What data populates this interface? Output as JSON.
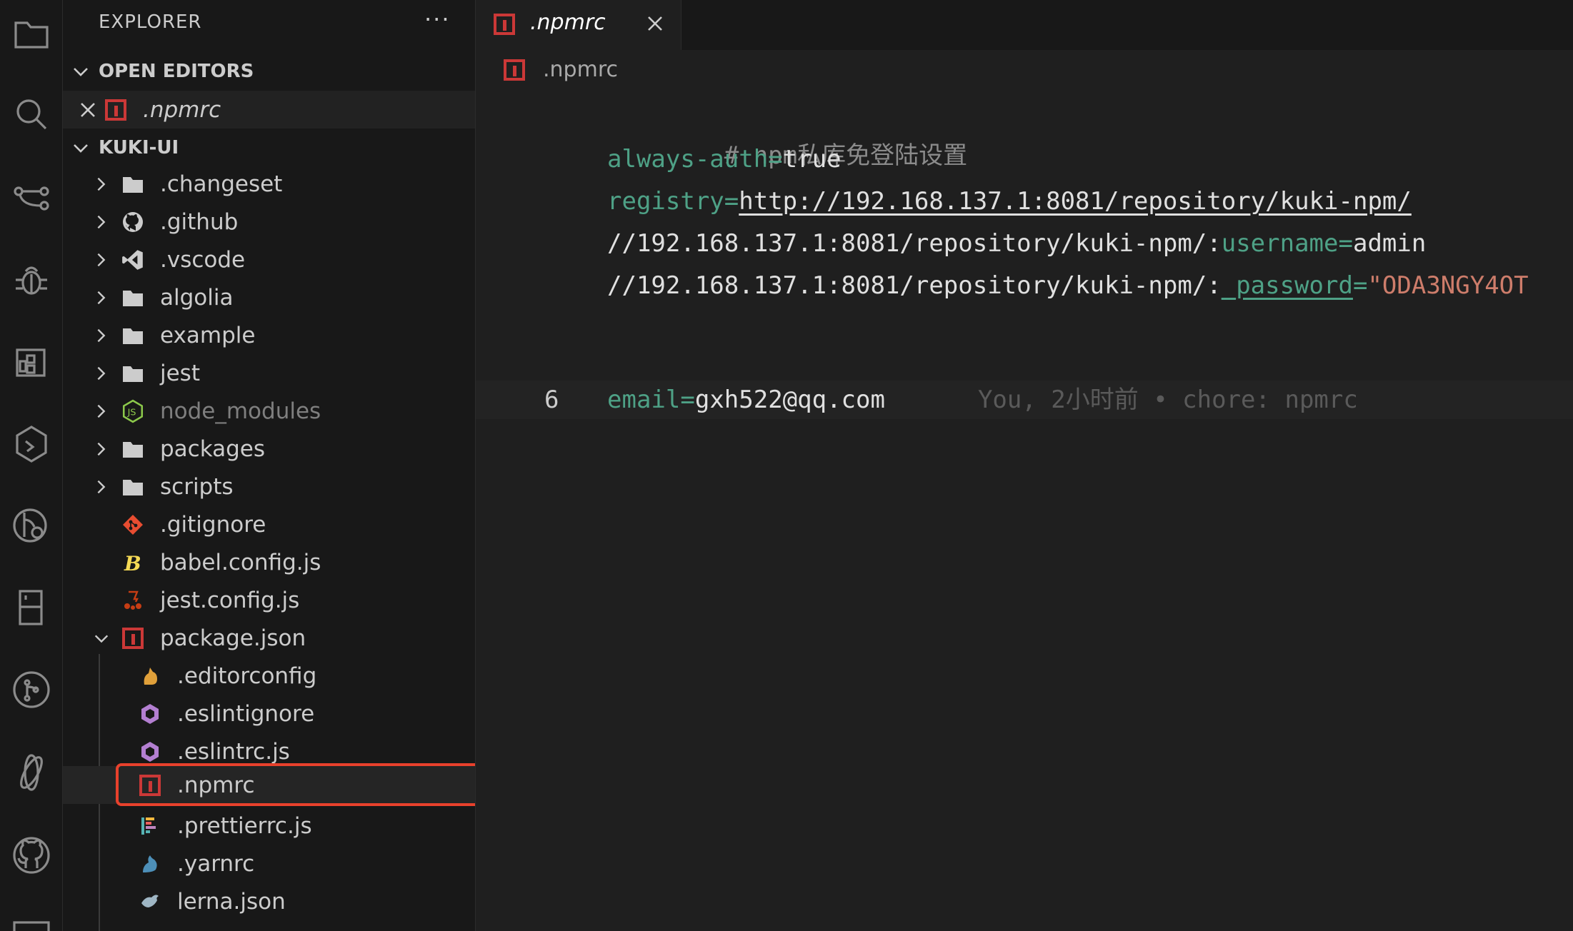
{
  "explorer": {
    "title": "EXPLORER",
    "more": "···",
    "open_editors": {
      "label": "OPEN EDITORS",
      "items": [
        ".npmrc"
      ]
    },
    "project": {
      "label": "KUKI-UI",
      "items": [
        {
          "label": ".changeset",
          "icon": "folder-icon"
        },
        {
          "label": ".github",
          "icon": "github-folder-icon"
        },
        {
          "label": ".vscode",
          "icon": "vscode-folder-icon"
        },
        {
          "label": "algolia",
          "icon": "folder-icon"
        },
        {
          "label": "example",
          "icon": "folder-icon"
        },
        {
          "label": "jest",
          "icon": "folder-icon"
        },
        {
          "label": "node_modules",
          "icon": "nodejs-folder-icon"
        },
        {
          "label": "packages",
          "icon": "folder-icon"
        },
        {
          "label": "scripts",
          "icon": "folder-icon"
        },
        {
          "label": ".gitignore",
          "icon": "git-icon"
        },
        {
          "label": "babel.config.js",
          "icon": "babel-icon"
        },
        {
          "label": "jest.config.js",
          "icon": "jest-icon"
        },
        {
          "label": "package.json",
          "icon": "npm-icon"
        },
        {
          "label": ".editorconfig",
          "icon": "editorconfig-icon"
        },
        {
          "label": ".eslintignore",
          "icon": "eslint-icon"
        },
        {
          "label": ".eslintrc.js",
          "icon": "eslint-icon"
        },
        {
          "label": ".npmrc",
          "icon": "npm-icon"
        },
        {
          "label": ".prettierrc.js",
          "icon": "prettier-icon"
        },
        {
          "label": ".yarnrc",
          "icon": "yarn-icon"
        },
        {
          "label": "lerna.json",
          "icon": "lerna-icon"
        }
      ]
    }
  },
  "editor": {
    "tab": {
      "label": ".npmrc"
    },
    "breadcrumb": ".npmrc",
    "current_line_number": "6",
    "lines": {
      "l1": "# npm私库免登陆设置",
      "l2_key": "always-auth",
      "l2_eq": "=",
      "l2_val": "true",
      "l3_key": "registry",
      "l3_eq": "=",
      "l3_val": "http://192.168.137.1:8081/repository/kuki-npm/",
      "l4_prefix": "//192.168.137.1:8081/repository/kuki-npm/:",
      "l4_key": "username",
      "l4_eq": "=",
      "l4_val": "admin",
      "l5_prefix": "//192.168.137.1:8081/repository/kuki-npm/:",
      "l5_key": "_password",
      "l5_eq": "=",
      "l5_val": "\"ODA3NGY4OT",
      "l6_key": "email",
      "l6_eq": "=",
      "l6_val": "gxh522@qq.com",
      "l6_blame": "You, 2小时前 • chore: npmrc"
    }
  },
  "colors": {
    "accent_highlight": "#e8412c",
    "npm_red": "#cb3837",
    "key_green": "#4ea186"
  }
}
